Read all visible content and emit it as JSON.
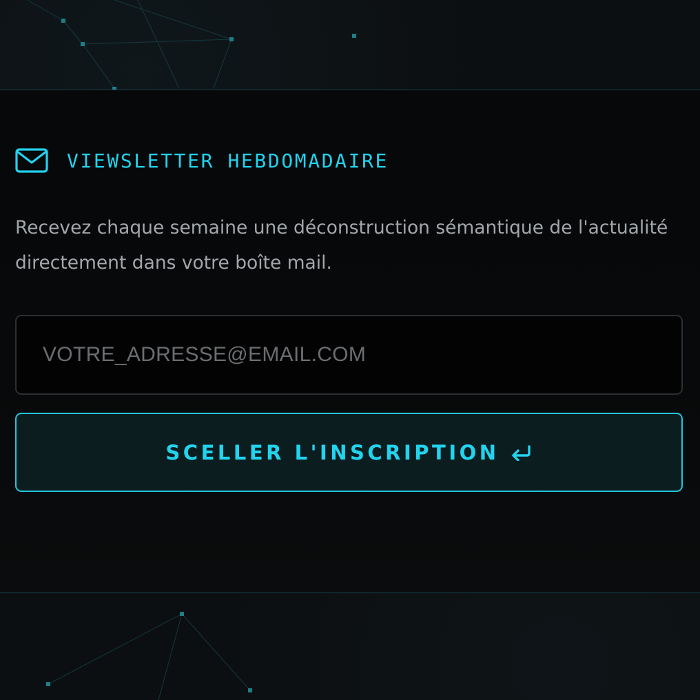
{
  "newsletter": {
    "title": "VIEWSLETTER HEBDOMADAIRE",
    "icon": "mail-icon",
    "description": "Recevez chaque semaine une déconstruction sémantique de l'actualité directement dans votre boîte mail.",
    "email": {
      "value": "",
      "placeholder": "VOTRE_ADRESSE@EMAIL.COM"
    },
    "submit": {
      "label": "SCELLER L'INSCRIPTION",
      "icon": "enter-arrow-icon"
    }
  },
  "colors": {
    "accent": "#22d3ee",
    "background": "#0c0f11",
    "panel": "#060809",
    "text_muted": "#a3a6aa",
    "input_border": "#2c2f31"
  }
}
